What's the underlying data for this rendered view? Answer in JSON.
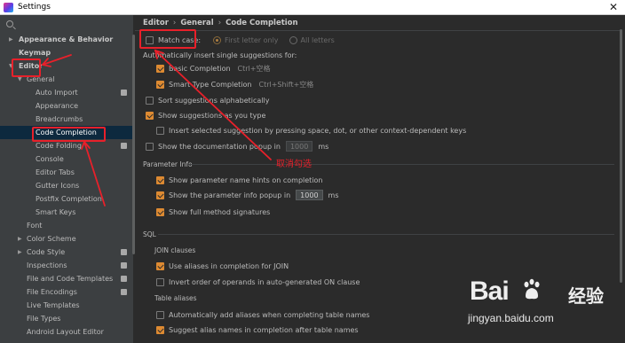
{
  "window": {
    "title": "Settings",
    "close": "✕"
  },
  "search": {
    "placeholder": ""
  },
  "sidebar": {
    "items": [
      {
        "label": "Appearance & Behavior",
        "depth": 0,
        "arrow": "▶",
        "bold": true
      },
      {
        "label": "Keymap",
        "depth": 0,
        "bold": true
      },
      {
        "label": "Editor",
        "depth": 0,
        "arrow": "▼",
        "bold": true
      },
      {
        "label": "General",
        "depth": 1,
        "arrow": "▼"
      },
      {
        "label": "Auto Import",
        "depth": 2,
        "badge": true
      },
      {
        "label": "Appearance",
        "depth": 2
      },
      {
        "label": "Breadcrumbs",
        "depth": 2
      },
      {
        "label": "Code Completion",
        "depth": 2,
        "selected": true
      },
      {
        "label": "Code Folding",
        "depth": 2,
        "badge": true
      },
      {
        "label": "Console",
        "depth": 2
      },
      {
        "label": "Editor Tabs",
        "depth": 2
      },
      {
        "label": "Gutter Icons",
        "depth": 2
      },
      {
        "label": "Postfix Completion",
        "depth": 2
      },
      {
        "label": "Smart Keys",
        "depth": 2
      },
      {
        "label": "Font",
        "depth": 1
      },
      {
        "label": "Color Scheme",
        "depth": 1,
        "arrow": "▶"
      },
      {
        "label": "Code Style",
        "depth": 1,
        "arrow": "▶",
        "badge": true
      },
      {
        "label": "Inspections",
        "depth": 1,
        "badge": true
      },
      {
        "label": "File and Code Templates",
        "depth": 1,
        "badge": true
      },
      {
        "label": "File Encodings",
        "depth": 1,
        "badge": true
      },
      {
        "label": "Live Templates",
        "depth": 1
      },
      {
        "label": "File Types",
        "depth": 1
      },
      {
        "label": "Android Layout Editor",
        "depth": 1
      }
    ]
  },
  "breadcrumb": {
    "part1": "Editor",
    "part2": "General",
    "part3": "Code Completion",
    "sep": "›"
  },
  "main": {
    "match_case": {
      "label": "Match case:",
      "checked": false
    },
    "first_letter_only": "First letter only",
    "all_letters": "All letters",
    "auto_insert_heading": "Automatically insert single suggestions for:",
    "basic_completion": {
      "label": "Basic Completion",
      "shortcut": "Ctrl+空格",
      "checked": true
    },
    "smart_type_completion": {
      "label": "Smart Type Completion",
      "shortcut": "Ctrl+Shift+空格",
      "checked": true
    },
    "sort_alpha": {
      "label": "Sort suggestions alphabetically",
      "checked": false
    },
    "show_as_you_type": {
      "label": "Show suggestions as you type",
      "checked": true
    },
    "insert_selected": {
      "label": "Insert selected suggestion by pressing space, dot, or other context-dependent keys",
      "checked": false
    },
    "show_doc_popup": {
      "label": "Show the documentation popup in",
      "value": "1000",
      "unit": "ms",
      "checked": false
    },
    "param_info_heading": "Parameter Info",
    "param_name_hints": {
      "label": "Show parameter name hints on completion",
      "checked": true
    },
    "param_info_popup": {
      "label": "Show the parameter info popup in",
      "value": "1000",
      "unit": "ms",
      "checked": true
    },
    "full_method_signatures": {
      "label": "Show full method signatures",
      "checked": true
    },
    "sql_heading": "SQL",
    "join_clauses_heading": "JOIN clauses",
    "use_aliases_join": {
      "label": "Use aliases in completion for JOIN",
      "checked": true
    },
    "invert_order": {
      "label": "Invert order of operands in auto-generated ON clause",
      "checked": false
    },
    "table_aliases_heading": "Table aliases",
    "auto_add_aliases": {
      "label": "Automatically add aliases when completing table names",
      "checked": false
    },
    "suggest_alias_names": {
      "label": "Suggest alias names in completion after table names",
      "checked": true
    }
  },
  "annotation": {
    "text": "取消勾选"
  },
  "watermark": {
    "brand_left": "Bai",
    "brand_right": "经验",
    "url": "jingyan.baidu.com"
  },
  "colors": {
    "accent_checkbox": "#dd8a32",
    "selection": "#0d293e",
    "annotation_red": "#e8202a"
  }
}
